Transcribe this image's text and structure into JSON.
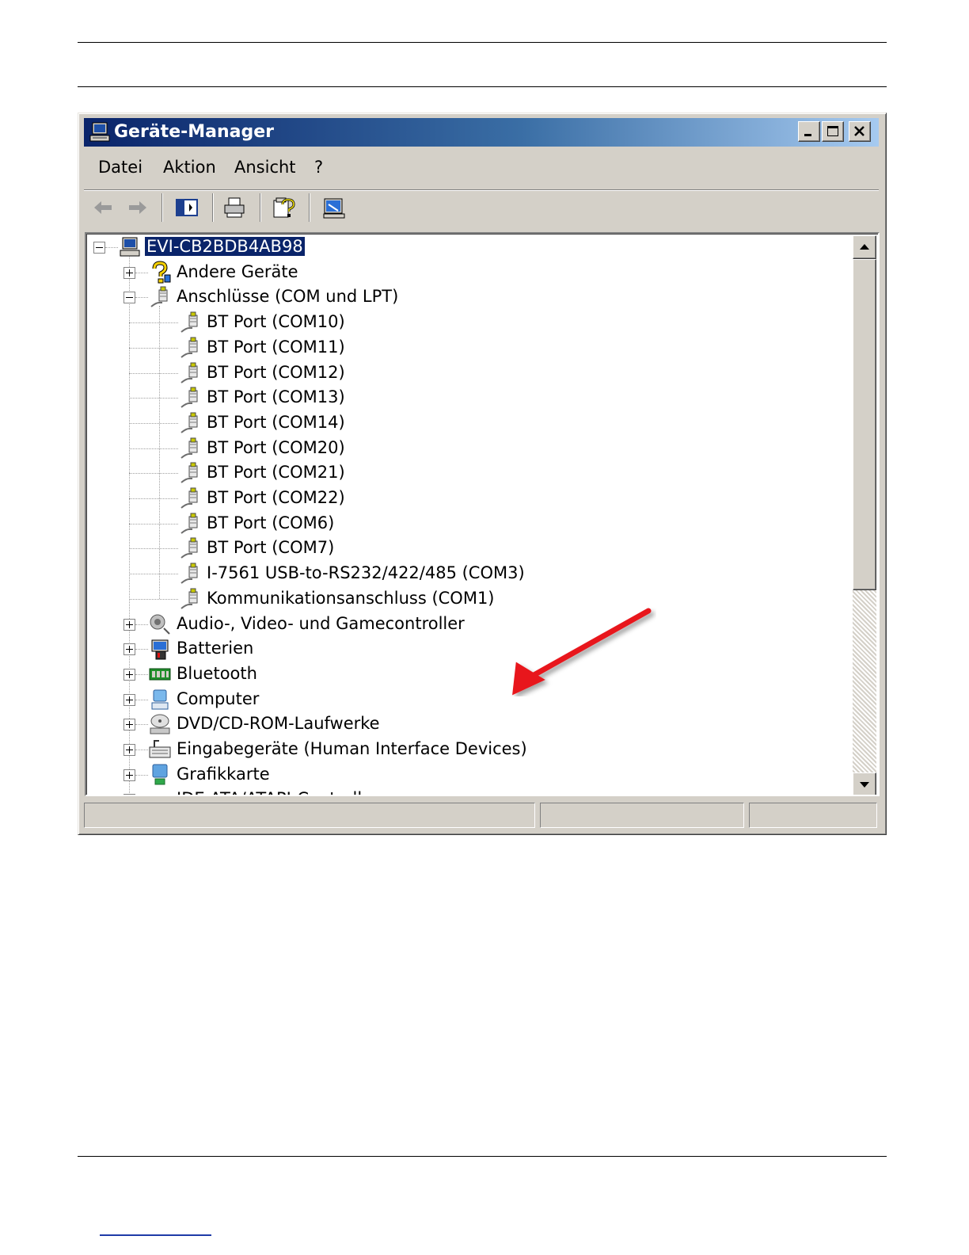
{
  "window": {
    "title": "Geräte-Manager",
    "controls": [
      "minimize",
      "maximize",
      "close"
    ]
  },
  "menu": [
    "Datei",
    "Aktion",
    "Ansicht",
    "?"
  ],
  "toolbar": {
    "buttons": [
      "back-arrow-icon",
      "forward-arrow-icon",
      "show-hide-console-tree-icon",
      "print-icon",
      "help-properties-icon",
      "scan-hardware-icon"
    ]
  },
  "tree": {
    "root": "EVI-CB2BDB4AB98",
    "categories": {
      "andere": "Andere Geräte",
      "anschluesse": "Anschlüsse (COM und LPT)",
      "audio": "Audio-, Video- und Gamecontroller",
      "batterien": "Batterien",
      "bluetooth": "Bluetooth",
      "computer": "Computer",
      "dvd": "DVD/CD-ROM-Laufwerke",
      "eingabe": "Eingabegeräte (Human Interface Devices)",
      "grafik": "Grafikkarte",
      "ide": "IDE ATA/ATAPI-Controller"
    },
    "ports": [
      "BT Port (COM10)",
      "BT Port (COM11)",
      "BT Port (COM12)",
      "BT Port (COM13)",
      "BT Port (COM14)",
      "BT Port (COM20)",
      "BT Port (COM21)",
      "BT Port (COM22)",
      "BT Port (COM6)",
      "BT Port (COM7)",
      "I-7561 USB-to-RS232/422/485 (COM3)",
      "Kommunikationsanschluss (COM1)"
    ]
  },
  "annotation": {
    "arrow_color": "#e8191f"
  },
  "colors": {
    "titlebar": "#0a246a",
    "selection": "#0a246a",
    "face": "#d4d0c8"
  }
}
